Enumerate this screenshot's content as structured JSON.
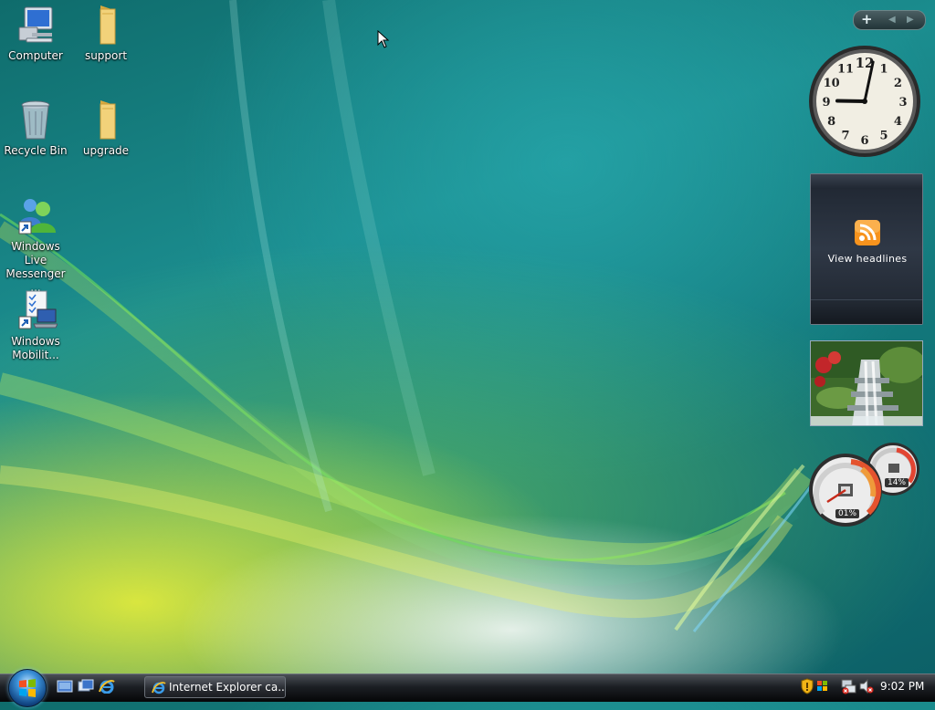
{
  "desktop": {
    "icons": [
      {
        "label": "Computer",
        "icon": "computer-icon"
      },
      {
        "label": "support",
        "icon": "folder-icon"
      },
      {
        "label": "Recycle Bin",
        "icon": "recycle-bin-icon"
      },
      {
        "label": "upgrade",
        "icon": "folder-icon"
      },
      {
        "label": "Windows Live Messenger ...",
        "icon": "messenger-icon"
      },
      {
        "label": "Windows Mobilit...",
        "icon": "mobility-center-icon"
      }
    ]
  },
  "sidebar": {
    "clock": {
      "hour": 9,
      "minute": 2,
      "numerals": [
        "12",
        "1",
        "2",
        "3",
        "4",
        "5",
        "6",
        "7",
        "8",
        "9",
        "10",
        "11"
      ]
    },
    "feed_headlines": {
      "label": "View headlines",
      "icon": "rss-icon"
    },
    "cpu_meter": {
      "cpu_percent": "01%",
      "memory_percent": "14%"
    }
  },
  "taskbar": {
    "start_button": "start-orb-icon",
    "quick_launch": [
      "show-desktop-icon",
      "switch-windows-icon",
      "internet-explorer-icon"
    ],
    "active_task": "Internet Explorer ca...",
    "tray_icons": [
      "security-shield-icon",
      "windows-update-icon",
      "network-icon",
      "volume-muted-icon"
    ],
    "clock": "9:02 PM"
  }
}
